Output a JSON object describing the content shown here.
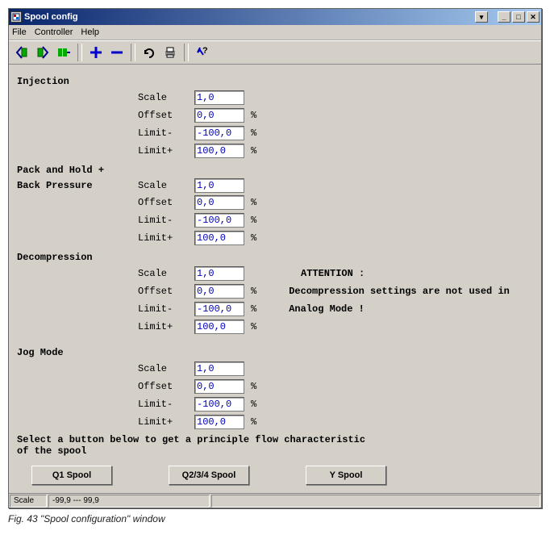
{
  "window": {
    "title": "Spool config"
  },
  "menu": {
    "file": "File",
    "controller": "Controller",
    "help": "Help"
  },
  "sections": {
    "injection": {
      "title": "Injection",
      "scale_label": "Scale",
      "scale": "1,0",
      "offset_label": "Offset",
      "offset": "0,0",
      "limitminus_label": "Limit-",
      "limitminus": "-100,0",
      "limitplus_label": "Limit+",
      "limitplus": "100,0"
    },
    "packhold": {
      "title1": "Pack and Hold +",
      "title2": "Back Pressure",
      "scale_label": "Scale",
      "scale": "1,0",
      "offset_label": "Offset",
      "offset": "0,0",
      "limitminus_label": "Limit-",
      "limitminus": "-100,0",
      "limitplus_label": "Limit+",
      "limitplus": "100,0"
    },
    "decomp": {
      "title": "Decompression",
      "scale_label": "Scale",
      "scale": "1,0",
      "offset_label": "Offset",
      "offset": "0,0",
      "limitminus_label": "Limit-",
      "limitminus": "-100,0",
      "limitplus_label": "Limit+",
      "limitplus": "100,0",
      "note1": "ATTENTION :",
      "note2": "Decompression settings are not used in",
      "note3": "Analog Mode !"
    },
    "jog": {
      "title": "Jog Mode",
      "scale_label": "Scale",
      "scale": "1,0",
      "offset_label": "Offset",
      "offset": "0,0",
      "limitminus_label": "Limit-",
      "limitminus": "-100,0",
      "limitplus_label": "Limit+",
      "limitplus": "100,0"
    }
  },
  "unit": "%",
  "instruction": "Select a button below to get a principle flow characteristic\nof the spool",
  "buttons": {
    "q1": "Q1 Spool",
    "q234": "Q2/3/4 Spool",
    "y": "Y Spool"
  },
  "status": {
    "label": "Scale",
    "range": "-99,9 --- 99,9"
  },
  "caption": "Fig. 43 \"Spool configuration\" window"
}
